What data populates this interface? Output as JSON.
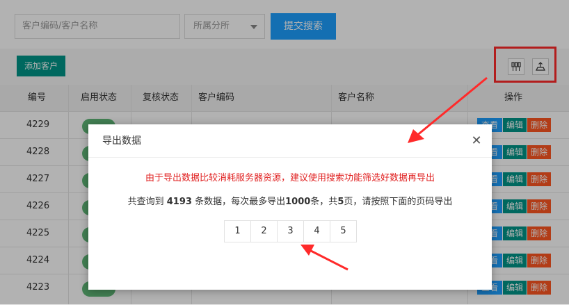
{
  "search": {
    "customer_placeholder": "客户编码/客户名称",
    "branch_placeholder": "所属分所",
    "submit_label": "提交搜索"
  },
  "toolbar": {
    "add_label": "添加客户",
    "columns_icon": "columns-icon",
    "export_icon": "export-icon"
  },
  "table": {
    "headers": [
      "编号",
      "启用状态",
      "复核状态",
      "客户编码",
      "客户名称",
      "操作"
    ],
    "rows": [
      {
        "id": "4229"
      },
      {
        "id": "4228"
      },
      {
        "id": "4227"
      },
      {
        "id": "4226"
      },
      {
        "id": "4225"
      },
      {
        "id": "4224"
      },
      {
        "id": "4223"
      }
    ],
    "op_view": "查看",
    "op_edit": "编辑",
    "op_delete": "删除"
  },
  "dialog": {
    "title": "导出数据",
    "warning": "由于导出数据比较消耗服务器资源，建议使用搜索功能筛选好数据再导出",
    "info_prefix": "共查询到",
    "count": "4193",
    "info_mid": "条数据，每次最多导出",
    "max_per": "1000",
    "info_mid2": "条，共",
    "pages_total": "5",
    "info_suffix": "页，请按照下面的页码导出",
    "pages": [
      "1",
      "2",
      "3",
      "4",
      "5"
    ]
  },
  "colors": {
    "primary": "#1e9fff",
    "green": "#009688",
    "danger": "#ff5722",
    "highlight": "#ff2a2a"
  }
}
